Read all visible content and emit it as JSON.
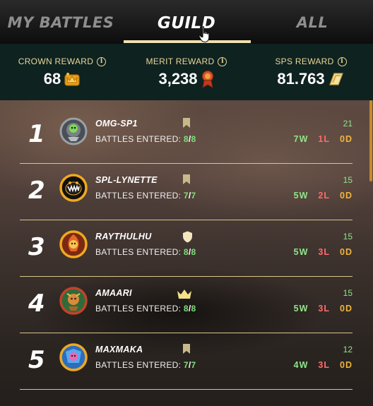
{
  "tabs": {
    "my_battles": "MY BATTLES",
    "guild": "GUILD",
    "all": "ALL",
    "active": "guild"
  },
  "rewards": {
    "crown": {
      "label": "CROWN REWARD",
      "value": "68"
    },
    "merit": {
      "label": "MERIT REWARD",
      "value": "3,238"
    },
    "sps": {
      "label": "SPS REWARD",
      "value": "81.763"
    }
  },
  "leaderboard": {
    "entered_label": "BATTLES ENTERED:",
    "rows": [
      {
        "rank": "1",
        "name": "OMG-SP1",
        "entered": "8",
        "total": "8",
        "score": "21",
        "wins": "7W",
        "losses": "1L",
        "draws": "0D",
        "role_icon": "bookmark-icon"
      },
      {
        "rank": "2",
        "name": "SPL-LYNETTE",
        "entered": "7",
        "total": "7",
        "score": "15",
        "wins": "5W",
        "losses": "2L",
        "draws": "0D",
        "role_icon": "bookmark-icon"
      },
      {
        "rank": "3",
        "name": "RAYTHULHU",
        "entered": "8",
        "total": "8",
        "score": "15",
        "wins": "5W",
        "losses": "3L",
        "draws": "0D",
        "role_icon": "shield-icon"
      },
      {
        "rank": "4",
        "name": "AMAARI",
        "entered": "8",
        "total": "8",
        "score": "15",
        "wins": "5W",
        "losses": "3L",
        "draws": "0D",
        "role_icon": "crown-icon"
      },
      {
        "rank": "5",
        "name": "MAXMAKA",
        "entered": "7",
        "total": "7",
        "score": "12",
        "wins": "4W",
        "losses": "3L",
        "draws": "0D",
        "role_icon": "bookmark-icon"
      }
    ]
  },
  "colors": {
    "accent": "#efe0b0",
    "win": "#8fe58a",
    "loss": "#ff6b6b",
    "draw": "#f0b43a"
  }
}
